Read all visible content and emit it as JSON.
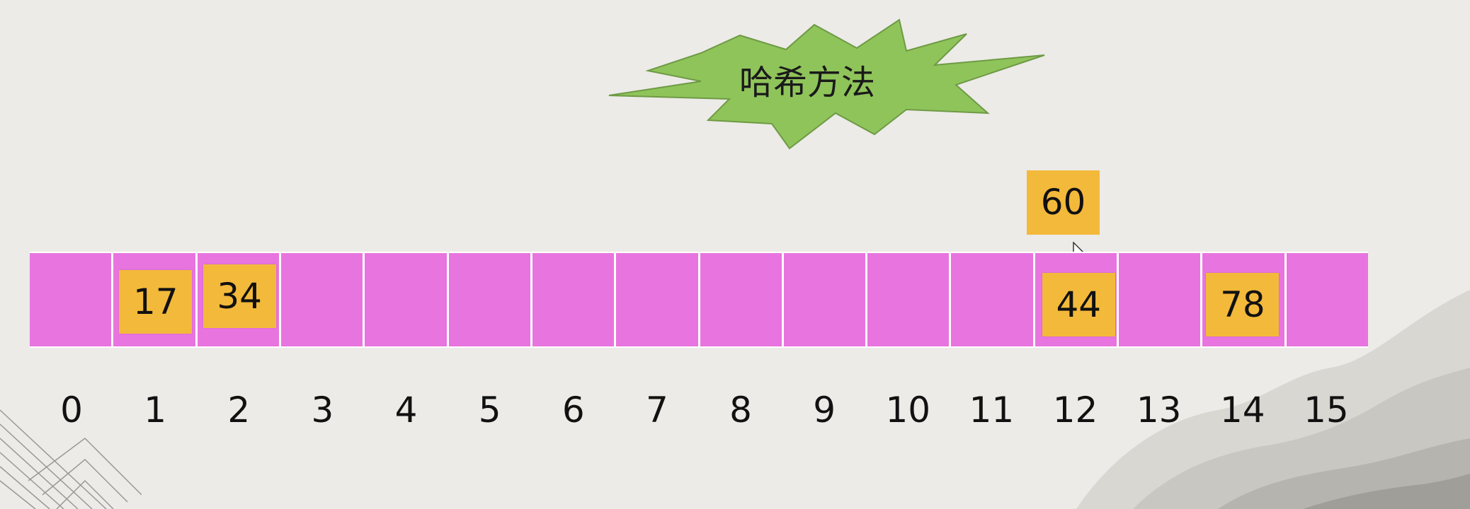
{
  "title": "哈希方法",
  "indices": [
    "0",
    "1",
    "2",
    "3",
    "4",
    "5",
    "6",
    "7",
    "8",
    "9",
    "10",
    "11",
    "12",
    "13",
    "14",
    "15"
  ],
  "slots": [
    {
      "index": 1,
      "value": "17"
    },
    {
      "index": 2,
      "value": "34"
    },
    {
      "index": 12,
      "value": "44"
    },
    {
      "index": 14,
      "value": "78"
    }
  ],
  "incoming_value": "60",
  "colors": {
    "cell": "#e874df",
    "value_box": "#f3b93a",
    "burst": "#8fc45a"
  }
}
